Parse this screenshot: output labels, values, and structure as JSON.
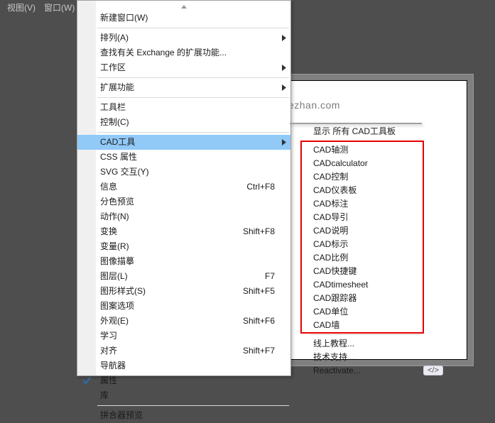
{
  "topbar": {
    "view": "视图(V)",
    "window": "窗口(W)"
  },
  "watermark": "yinghezhan.com",
  "codeTag": "</>",
  "mainMenu": {
    "newWindow": "新建窗口(W)",
    "arrange": {
      "label": "排列(A)",
      "sub": true
    },
    "findExt": "查找有关 Exchange 的扩展功能...",
    "workspace": {
      "label": "工作区",
      "sub": true
    },
    "extensions": {
      "label": "扩展功能",
      "sub": true
    },
    "toolbar": "工具栏",
    "control": "控制(C)",
    "cadtools": {
      "label": "CAD工具",
      "sub": true,
      "highlight": true
    },
    "cssProps": "CSS 属性",
    "svgInter": "SVG 交互(Y)",
    "info": {
      "label": "信息",
      "short": "Ctrl+F8"
    },
    "sepPreview": "分色预览",
    "actions": "动作(N)",
    "transform": {
      "label": "变换",
      "short": "Shift+F8"
    },
    "variables": "变量(R)",
    "imageTrace": "图像描摹",
    "layers": {
      "label": "图层(L)",
      "short": "F7"
    },
    "gfxStyles": {
      "label": "图形样式(S)",
      "short": "Shift+F5"
    },
    "patternOpt": "图案选项",
    "appearance": {
      "label": "外观(E)",
      "short": "Shift+F6"
    },
    "learn": "学习",
    "align": {
      "label": "对齐",
      "short": "Shift+F7"
    },
    "navigator": "导航器",
    "properties": {
      "label": "属性",
      "checked": true
    },
    "library": "库",
    "flattener": "拼合器预览"
  },
  "subMenu": {
    "header": "显示 所有 CAD工具板",
    "items": [
      "CAD轴测",
      "CADcalculator",
      "CAD控制",
      "CAD仪表板",
      "CAD标注",
      "CAD导引",
      "CAD说明",
      "CAD标示",
      "CAD比例",
      "CAD快捷键",
      "CADtimesheet",
      "CAD跟踪器",
      "CAD单位",
      "CAD墙"
    ],
    "footer": [
      "线上教程...",
      "技术支持...",
      "Reactivate..."
    ]
  }
}
